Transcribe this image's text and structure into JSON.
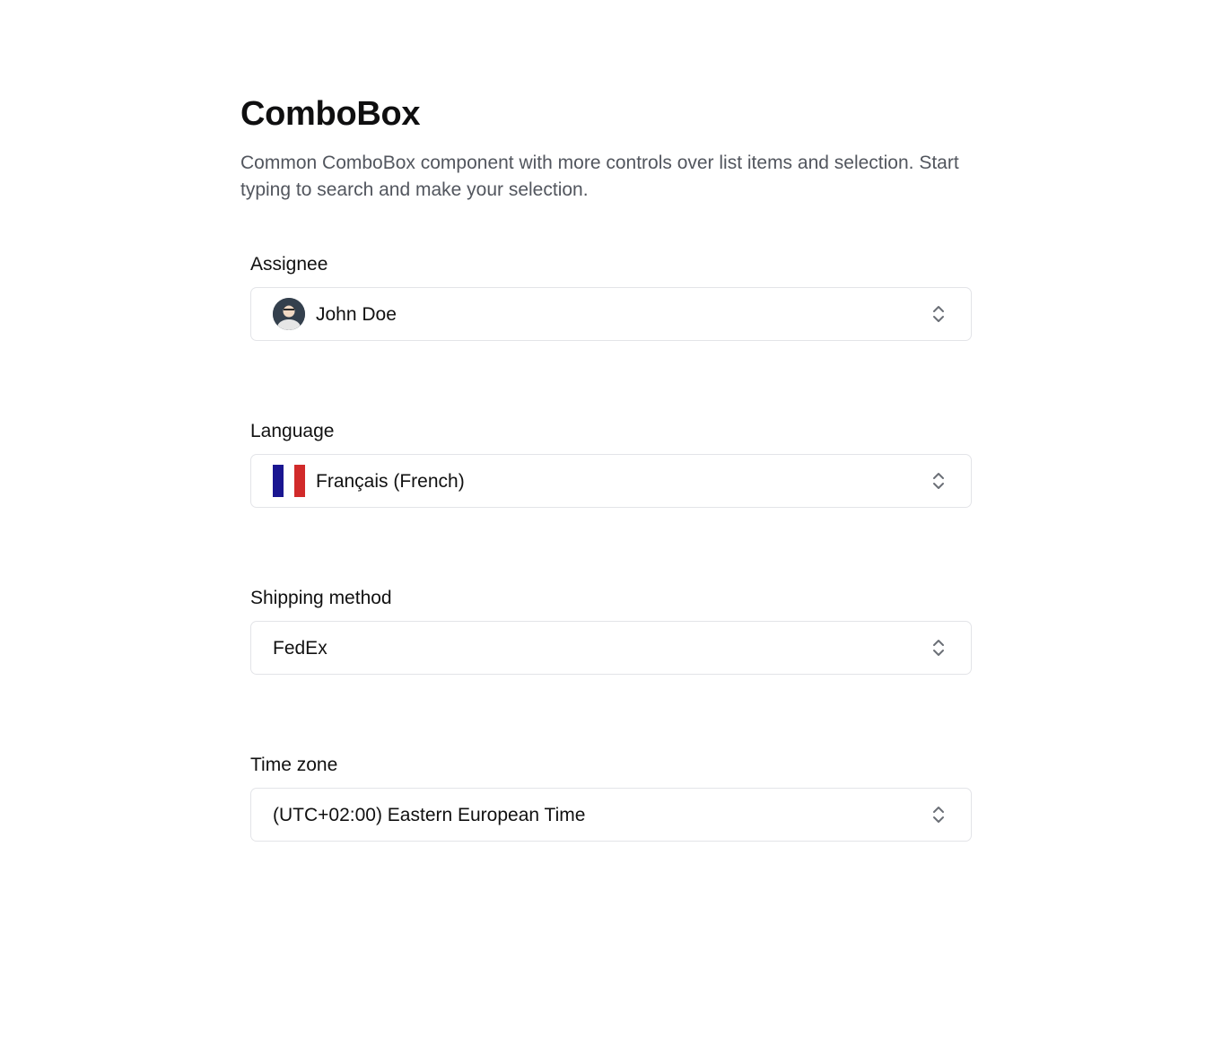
{
  "header": {
    "title": "ComboBox",
    "description": "Common ComboBox component with more controls over list items and selection. Start typing to search and make your selection."
  },
  "fields": {
    "assignee": {
      "label": "Assignee",
      "value": "John Doe",
      "leading": "avatar"
    },
    "language": {
      "label": "Language",
      "value": "Français (French)",
      "leading": "france-flag",
      "flag_colors": [
        "#1a1691",
        "#ffffff",
        "#d12a2a"
      ]
    },
    "shipping": {
      "label": "Shipping method",
      "value": "FedEx"
    },
    "timezone": {
      "label": "Time zone",
      "value": "(UTC+02:00) Eastern European Time"
    }
  },
  "icons": {
    "trigger": "chevron-up-down-icon"
  },
  "colors": {
    "border": "#e3e4e8",
    "muted_text": "#52565e",
    "text": "#111111"
  }
}
